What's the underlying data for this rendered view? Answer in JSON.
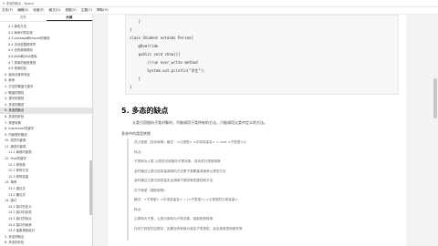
{
  "window": {
    "title": "5. 多态的缺点 - Typora"
  },
  "menubar": {
    "items": [
      "文件(F)",
      "编辑(E)",
      "段落(P)",
      "格式(O)",
      "视图(V)",
      "主题(T)",
      "帮助(H)"
    ]
  },
  "sidebar": {
    "tabs": [
      "文件",
      "大纲"
    ],
    "active_tab": "大纲",
    "items": [
      {
        "label": "4.1 静态方法",
        "level": 2
      },
      {
        "label": "4.2 继承中的实现",
        "level": 2
      },
      {
        "label": "4.3 package和import的使用",
        "level": 2
      },
      {
        "label": "4.4 访问权限修饰符",
        "level": 2
      },
      {
        "label": "4.5 包的使用规则",
        "level": 2
      },
      {
        "label": "4.6 JAVA和JAVA类库",
        "level": 2
      },
      {
        "label": "4.7 类库的使用规则",
        "level": 2
      },
      {
        "label": "4.8 常用的包",
        "level": 2
      },
      {
        "label": "5. 面向对象的特征",
        "level": 1
      },
      {
        "label": "6. 继承",
        "level": 1
      },
      {
        "label": "1. 方法的覆盖与重写",
        "level": 1
      },
      {
        "label": "2. 覆盖的规则",
        "level": 1
      },
      {
        "label": "3. 重写的规则",
        "level": 1
      },
      {
        "label": "4. 多态的概述",
        "level": 1
      },
      {
        "label": "5. 多态的缺点",
        "level": 1
      },
      {
        "label": "6. 多态的好处",
        "level": 1
      },
      {
        "label": "7. 类型转换",
        "level": 1
      },
      {
        "label": "8. instanceof关键字",
        "level": 1
      },
      {
        "label": "9. 内部类的概述",
        "level": 1
      },
      {
        "label": "10. 成员内部类",
        "level": 1
      },
      {
        "label": "11. 静态内部类",
        "level": 1
      },
      {
        "label": "11.1 局部内部类",
        "level": 2
      },
      {
        "label": "12. final关键字",
        "level": 1
      },
      {
        "label": "12.1 修饰类",
        "level": 2
      },
      {
        "label": "12.2 修饰方法",
        "level": 2
      },
      {
        "label": "12.3 修饰变量",
        "level": 2
      },
      {
        "label": "13. 单例",
        "level": 1
      },
      {
        "label": "13.1 饿汉式",
        "level": 2
      },
      {
        "label": "13.2 懒汉式",
        "level": 2
      },
      {
        "label": "14. 接口",
        "level": 1
      },
      {
        "label": "14.1 接口的定义",
        "level": 2
      },
      {
        "label": "14.2 接口的实现",
        "level": 2
      },
      {
        "label": "14.3 接口的特点",
        "level": 2
      },
      {
        "label": "14.4 接口的继承",
        "level": 2
      },
      {
        "label": "14.5 抽象类和接口",
        "level": 2
      },
      {
        "label": "5. 多态的缺点",
        "level": 1
      },
      {
        "label": "6. 多态的好处",
        "level": 1
      }
    ],
    "active_index": 14
  },
  "code": {
    "lines": [
      "    }",
      "}",
      "class Student extends Person{",
      "    @Override",
      "    public void show(){",
      "        //run over_write method",
      "        System.out.println(\"学生\");",
      "    }",
      "}"
    ]
  },
  "content": {
    "heading": "5. 多态的缺点",
    "para1": "父类引用指向子类对象时，不能调用子类特有的方法，只能调用父类中定义的方法。",
    "para2": "多态中的类型转换",
    "quote_lines": [
      "向上转型（自动转换）格式：<父类型> <引用变量名> = new <子类型>();",
      "特点：",
      "子类转为父类 父类的引用指向子类对象。自动进行类型转换",
      "此时通过父类引用变量调用的方法是子类覆盖或继承父类的方法",
      "此时通过父类引用变量无法调用子类特有的属性和方法",
      "向下转型（强制转换）",
      "格式：<子类型> <引用变量名> = (<子类型>) <父类型的引用变量>;",
      "特点：",
      "父类转为子类，父类引用转为子类对象。强制类型转换",
      "在向下转型的过程中，如果没有转换为真实子类类型，会出现类型转换异常"
    ]
  }
}
